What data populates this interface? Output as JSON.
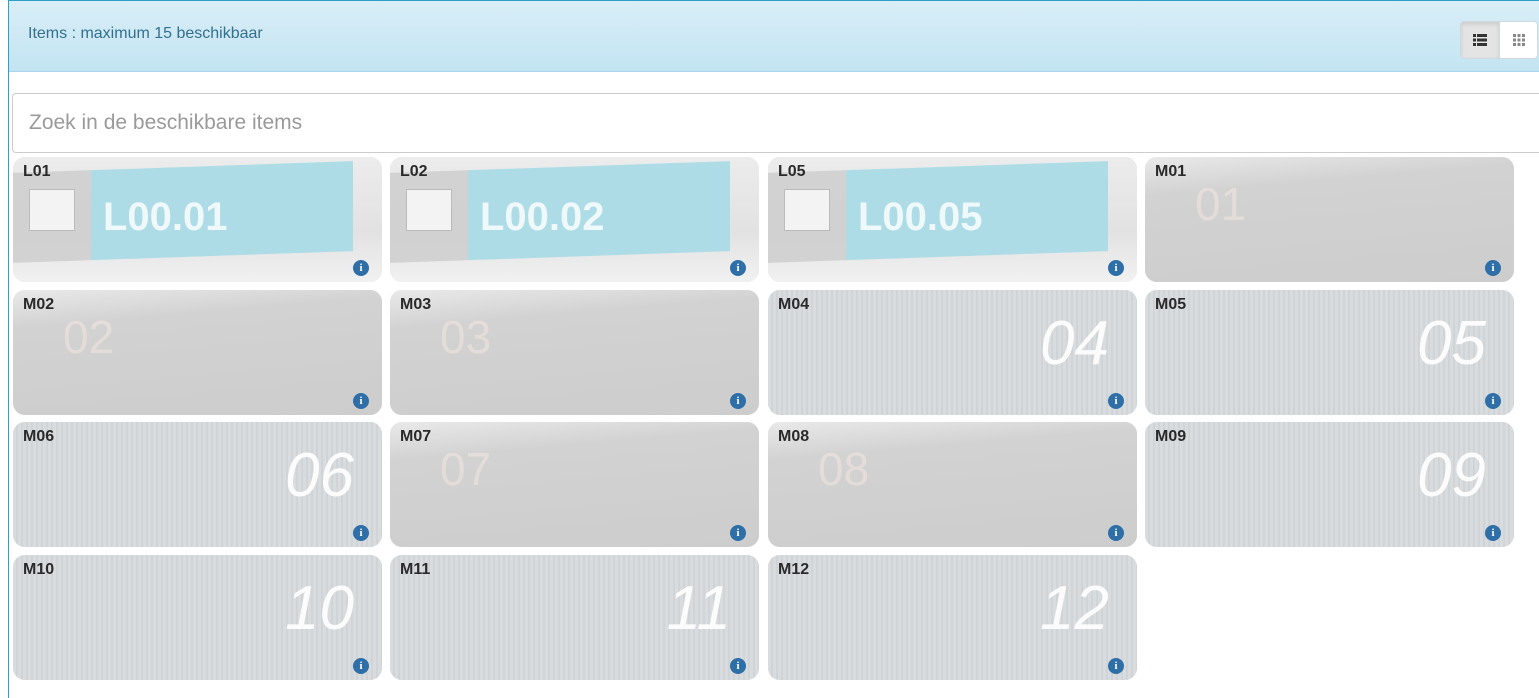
{
  "header": {
    "title": "Items : maximum 15 beschikbaar",
    "view_list_icon": "list-view-icon",
    "view_grid_icon": "grid-view-icon"
  },
  "search": {
    "placeholder": "Zoek in de beschikbare items"
  },
  "items": [
    {
      "code": "L01",
      "number": "L00.01",
      "style": "label"
    },
    {
      "code": "L02",
      "number": "L00.02",
      "style": "label"
    },
    {
      "code": "L05",
      "number": "L00.05",
      "style": "label"
    },
    {
      "code": "M01",
      "number": "01",
      "style": "dark"
    },
    {
      "code": "M02",
      "number": "02",
      "style": "dark"
    },
    {
      "code": "M03",
      "number": "03",
      "style": "dark"
    },
    {
      "code": "M04",
      "number": "04",
      "style": "light"
    },
    {
      "code": "M05",
      "number": "05",
      "style": "light"
    },
    {
      "code": "M06",
      "number": "06",
      "style": "light"
    },
    {
      "code": "M07",
      "number": "07",
      "style": "dark"
    },
    {
      "code": "M08",
      "number": "08",
      "style": "dark"
    },
    {
      "code": "M09",
      "number": "09",
      "style": "light"
    },
    {
      "code": "M10",
      "number": "10",
      "style": "light"
    },
    {
      "code": "M11",
      "number": "11",
      "style": "light"
    },
    {
      "code": "M12",
      "number": "12",
      "style": "light"
    }
  ],
  "colors": {
    "info_icon": "#2f6fa8",
    "heading_text": "#31708f",
    "label_blue": "#a7dbe6"
  },
  "info_icon": "info-icon"
}
